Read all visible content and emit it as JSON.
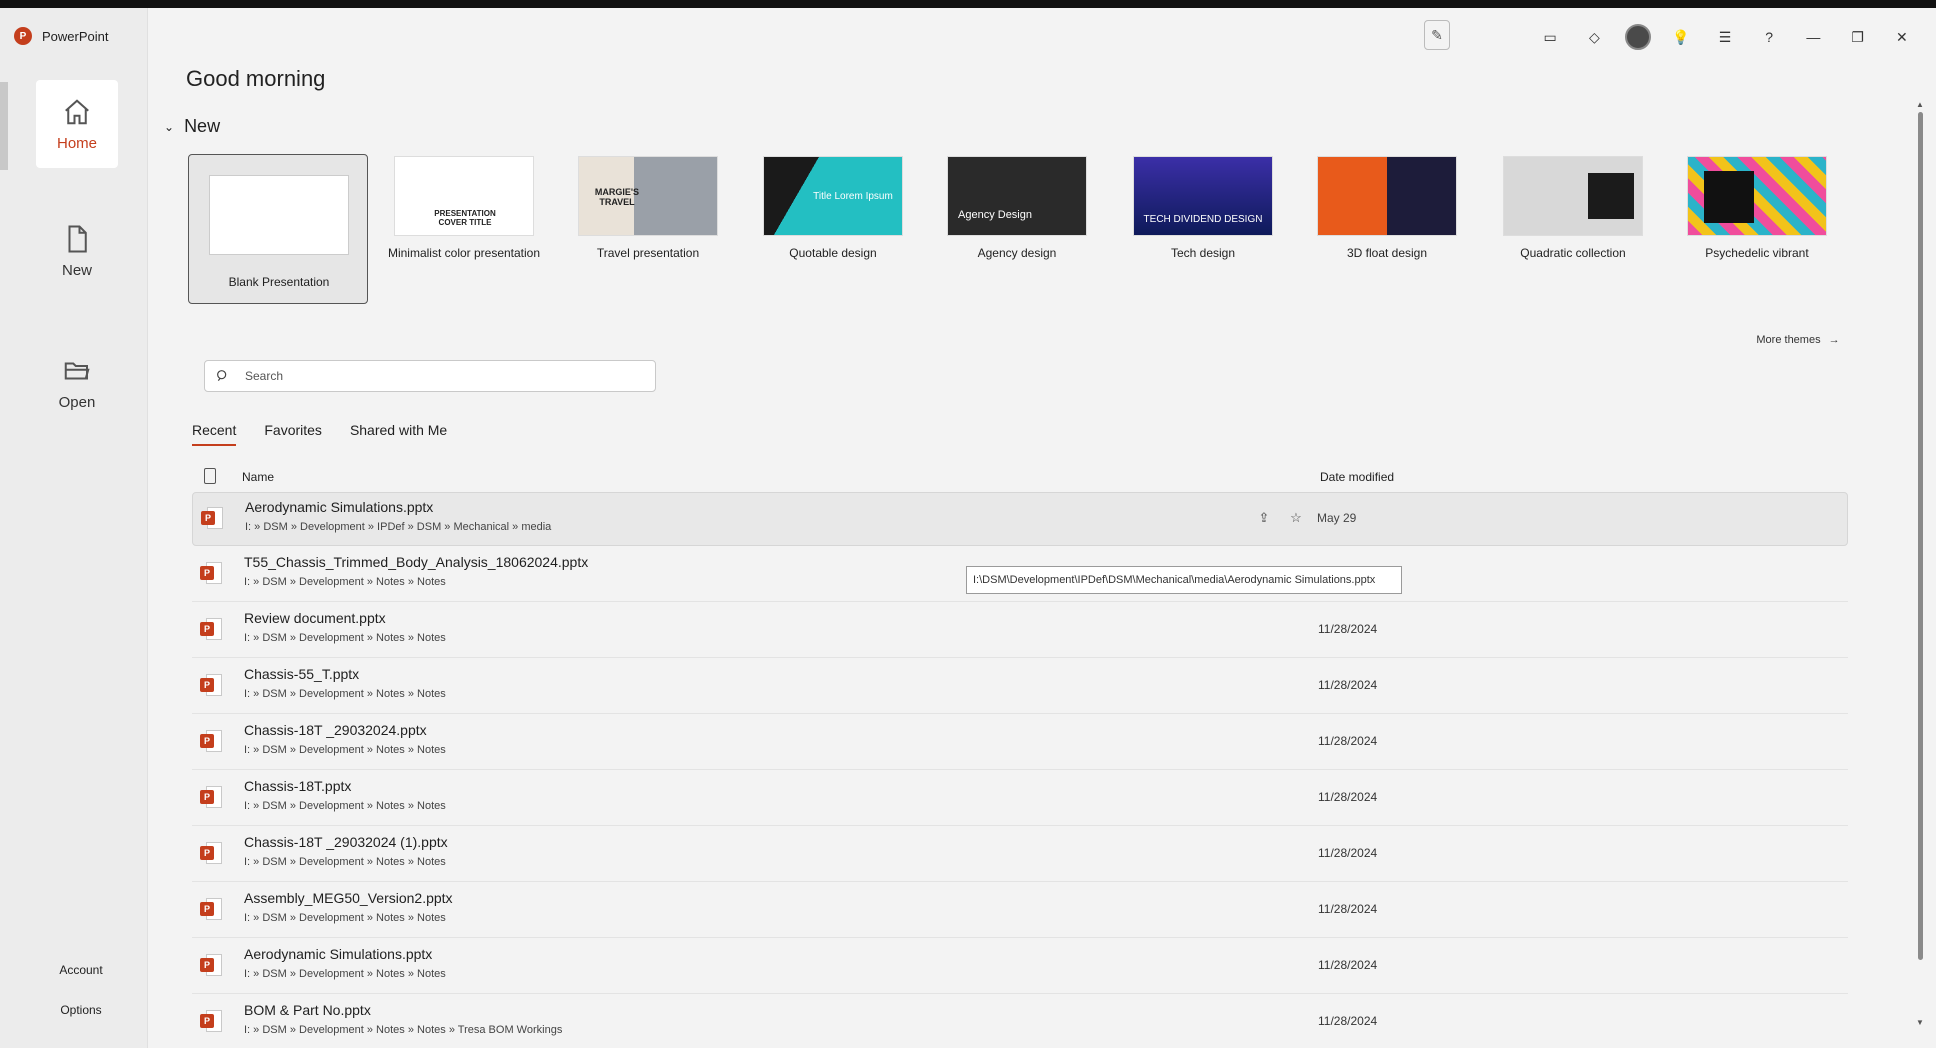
{
  "app": {
    "title": "PowerPoint",
    "logo": "P"
  },
  "sidebar": {
    "home": "Home",
    "new": "New",
    "open": "Open",
    "account": "Account",
    "options": "Options"
  },
  "titlebar": {
    "help": "?",
    "minimize": "—",
    "restore": "❐",
    "close": "✕"
  },
  "main": {
    "greeting": "Good morning",
    "new_section": "New",
    "templates": [
      {
        "label": "Blank Presentation"
      },
      {
        "label": "Minimalist color presentation",
        "thumb_text": "PRESENTATION COVER TITLE"
      },
      {
        "label": "Travel presentation",
        "thumb_text": "MARGIE'S TRAVEL"
      },
      {
        "label": "Quotable design",
        "thumb_text": "Title Lorem Ipsum"
      },
      {
        "label": "Agency design",
        "thumb_text": "Agency Design"
      },
      {
        "label": "Tech design",
        "thumb_text": "TECH DIVIDEND DESIGN"
      },
      {
        "label": "3D float design"
      },
      {
        "label": "Quadratic collection"
      },
      {
        "label": "Psychedelic vibrant"
      }
    ],
    "more_themes": "More themes",
    "search_placeholder": "Search",
    "tabs": [
      "Recent",
      "Favorites",
      "Shared with Me"
    ],
    "columns": {
      "name": "Name",
      "date": "Date modified"
    },
    "tooltip": "I:\\DSM\\Development\\IPDef\\DSM\\Mechanical\\media\\Aerodynamic Simulations.pptx",
    "files": [
      {
        "name": "Aerodynamic Simulations.pptx",
        "path": "I: » DSM » Development » IPDef » DSM » Mechanical » media",
        "date": "May 29"
      },
      {
        "name": "T55_Chassis_Trimmed_Body_Analysis_18062024.pptx",
        "path": "I: » DSM » Development » Notes » Notes",
        "date": ""
      },
      {
        "name": "Review document.pptx",
        "path": "I: » DSM » Development » Notes » Notes",
        "date": "11/28/2024"
      },
      {
        "name": "Chassis-55_T.pptx",
        "path": "I: » DSM » Development » Notes » Notes",
        "date": "11/28/2024"
      },
      {
        "name": "Chassis-18T _29032024.pptx",
        "path": "I: » DSM » Development » Notes » Notes",
        "date": "11/28/2024"
      },
      {
        "name": "Chassis-18T.pptx",
        "path": "I: » DSM » Development » Notes » Notes",
        "date": "11/28/2024"
      },
      {
        "name": "Chassis-18T _29032024 (1).pptx",
        "path": "I: » DSM » Development » Notes » Notes",
        "date": "11/28/2024"
      },
      {
        "name": "Assembly_MEG50_Version2.pptx",
        "path": "I: » DSM » Development » Notes » Notes",
        "date": "11/28/2024"
      },
      {
        "name": "Aerodynamic Simulations.pptx",
        "path": "I: » DSM » Development » Notes » Notes",
        "date": "11/28/2024"
      },
      {
        "name": "BOM & Part No.pptx",
        "path": "I: » DSM » Development » Notes » Notes » Tresa BOM Workings",
        "date": "11/28/2024"
      }
    ]
  },
  "colors": {
    "accent": "#c43e1c",
    "background": "#f3f3f3",
    "sidebar": "#ececec"
  }
}
